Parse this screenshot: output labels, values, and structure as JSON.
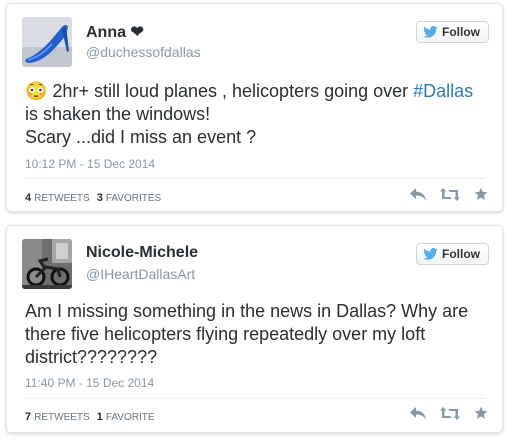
{
  "colors": {
    "link": "#2b7bb9",
    "muted": "#8899a6",
    "text": "#292f33",
    "follow_bird": "#55acee"
  },
  "tweets": [
    {
      "name": "Anna ❤",
      "handle": "@duchessofdallas",
      "follow_label": "Follow",
      "emoji": "😳",
      "text_before": " 2hr+ still loud planes , helicopters going over ",
      "hashtag": "#Dallas",
      "text_after": " is shaken the windows!",
      "text_line2": "Scary ...did I miss an event ?",
      "timestamp": "10:12 PM - 15 Dec 2014",
      "retweets_count": "4",
      "retweets_label": "Retweets",
      "favorites_count": "3",
      "favorites_label": "Favorites",
      "avatar_icon": "blue-high-heel-shoe"
    },
    {
      "name": "Nicole-Michele",
      "handle": "@IHeartDallasArt",
      "follow_label": "Follow",
      "text": "Am I missing something in the news in Dallas? Why are there five helicopters flying repeatedly over my loft district????????",
      "timestamp": "11:40 PM - 15 Dec 2014",
      "retweets_count": "7",
      "retweets_label": "Retweets",
      "favorites_count": "1",
      "favorites_label": "Favorite",
      "avatar_icon": "motorcycle-photo"
    }
  ],
  "icons": {
    "reply": "reply-icon",
    "retweet": "retweet-icon",
    "favorite": "star-icon",
    "bird": "twitter-bird-icon"
  }
}
